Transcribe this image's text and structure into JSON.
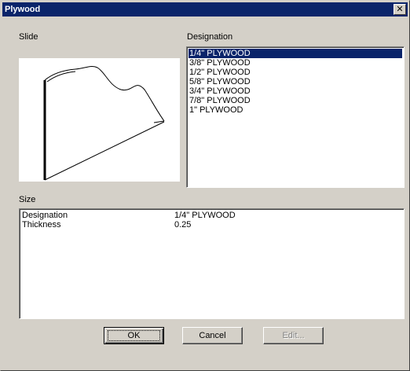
{
  "window": {
    "title": "Plywood",
    "close_glyph": "✕"
  },
  "slide": {
    "label": "Slide"
  },
  "designation": {
    "label": "Designation",
    "items": [
      "1/4\" PLYWOOD",
      "3/8\" PLYWOOD",
      "1/2\" PLYWOOD",
      "5/8\" PLYWOOD",
      "3/4\" PLYWOOD",
      "7/8\" PLYWOOD",
      "1\" PLYWOOD"
    ],
    "selected_index": 0
  },
  "size": {
    "label": "Size",
    "rows": [
      {
        "name": "Designation",
        "value": "1/4\" PLYWOOD"
      },
      {
        "name": "Thickness",
        "value": "0.25"
      }
    ]
  },
  "buttons": {
    "ok": "OK",
    "cancel": "Cancel",
    "edit": "Edit..."
  },
  "colors": {
    "titlebar": "#0a246a",
    "dialog_bg": "#d4d0c8",
    "selection": "#0a246a"
  }
}
